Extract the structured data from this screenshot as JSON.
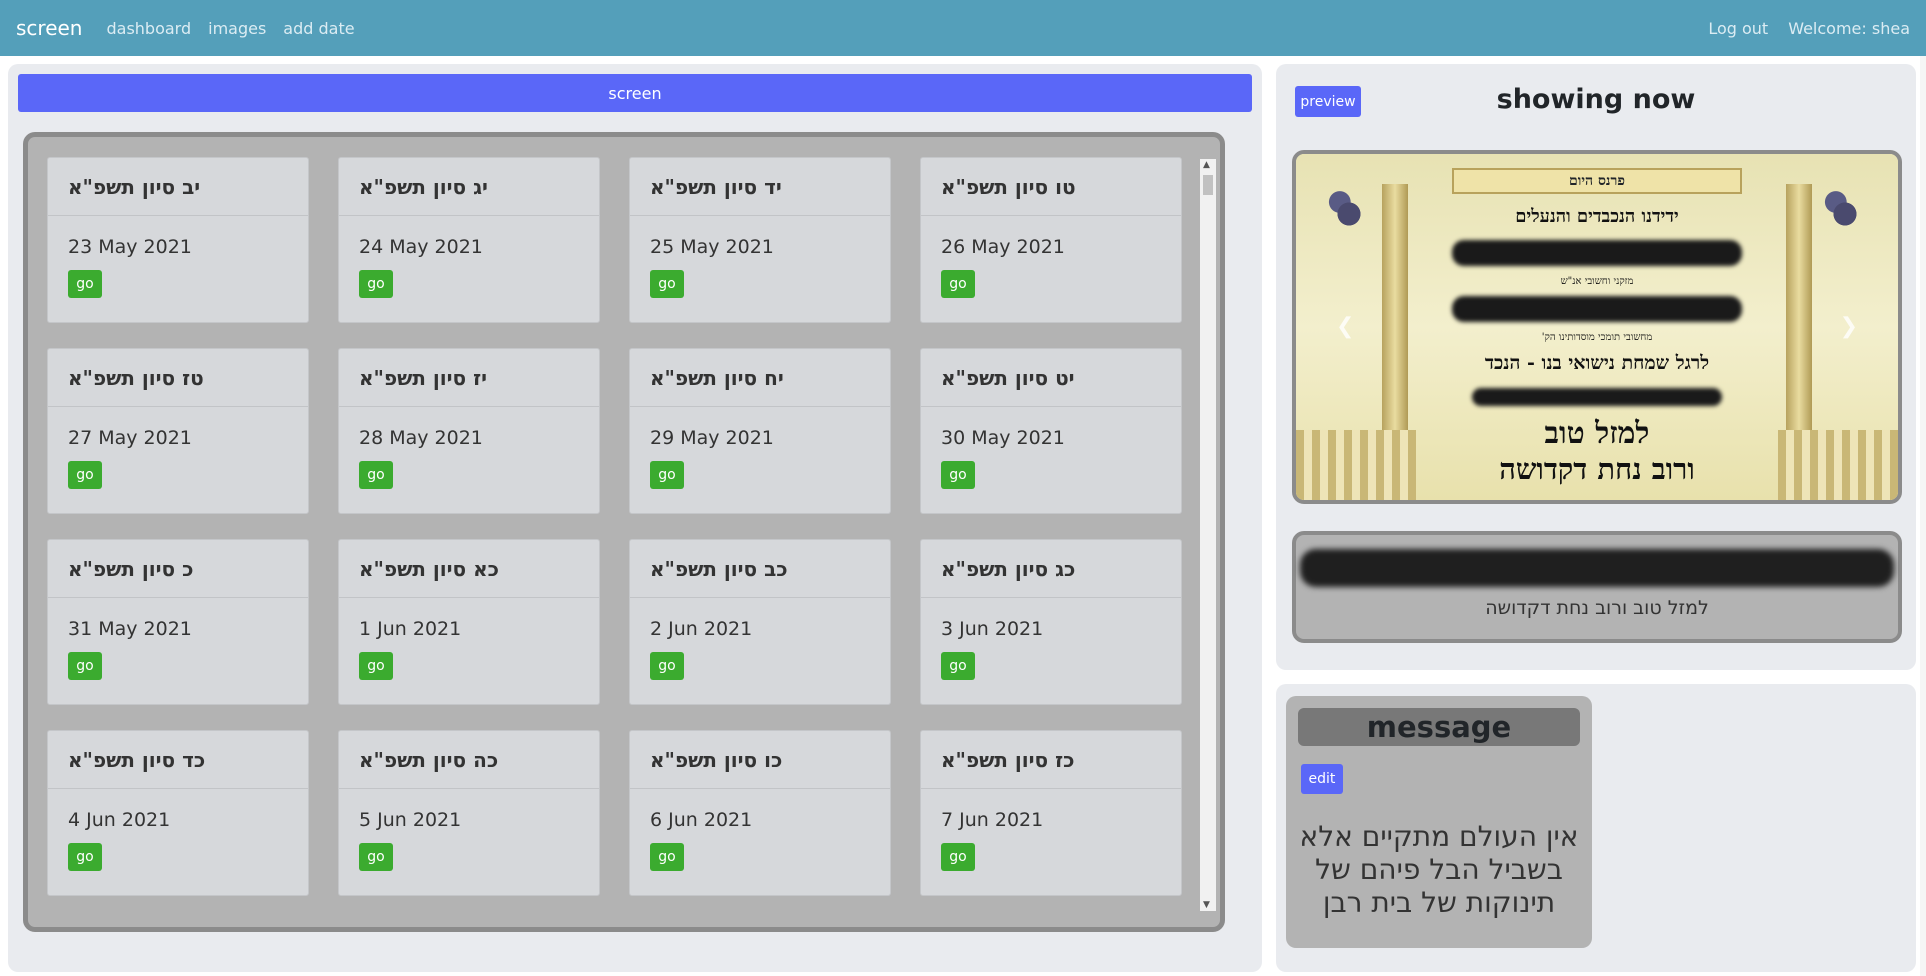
{
  "navbar": {
    "brand": "screen",
    "links": [
      "dashboard",
      "images",
      "add date"
    ],
    "logout": "Log out",
    "welcome": "Welcome: shea"
  },
  "screen_button": "screen",
  "dates": [
    {
      "hebrew": "יב סיון תשפ\"א",
      "date": "23 May 2021",
      "go": "go"
    },
    {
      "hebrew": "יג סיון תשפ\"א",
      "date": "24 May 2021",
      "go": "go"
    },
    {
      "hebrew": "יד סיון תשפ\"א",
      "date": "25 May 2021",
      "go": "go"
    },
    {
      "hebrew": "טו סיון תשפ\"א",
      "date": "26 May 2021",
      "go": "go"
    },
    {
      "hebrew": "טז סיון תשפ\"א",
      "date": "27 May 2021",
      "go": "go"
    },
    {
      "hebrew": "יז סיון תשפ\"א",
      "date": "28 May 2021",
      "go": "go"
    },
    {
      "hebrew": "יח סיון תשפ\"א",
      "date": "29 May 2021",
      "go": "go"
    },
    {
      "hebrew": "יט סיון תשפ\"א",
      "date": "30 May 2021",
      "go": "go"
    },
    {
      "hebrew": "כ סיון תשפ\"א",
      "date": "31 May 2021",
      "go": "go"
    },
    {
      "hebrew": "כא סיון תשפ\"א",
      "date": "1 Jun 2021",
      "go": "go"
    },
    {
      "hebrew": "כב סיון תשפ\"א",
      "date": "2 Jun 2021",
      "go": "go"
    },
    {
      "hebrew": "כג סיון תשפ\"א",
      "date": "3 Jun 2021",
      "go": "go"
    },
    {
      "hebrew": "כד סיון תשפ\"א",
      "date": "4 Jun 2021",
      "go": "go"
    },
    {
      "hebrew": "כה סיון תשפ\"א",
      "date": "5 Jun 2021",
      "go": "go"
    },
    {
      "hebrew": "כו סיון תשפ\"א",
      "date": "6 Jun 2021",
      "go": "go"
    },
    {
      "hebrew": "כז סיון תשפ\"א",
      "date": "7 Jun 2021",
      "go": "go"
    }
  ],
  "showing_now": {
    "preview_button": "preview",
    "title": "showing now",
    "slide": {
      "header": "פרנס היום",
      "line1": "ידידנו הנכבדים והנעלים",
      "line2": "מזקני וחשובי אנ\"ש",
      "line3": "מחשובי תומכי מוסדותינו הק'",
      "line4": "לרגל שמחת נישואי בנו - הנכד",
      "line5": "למזל טוב",
      "line6": "ורוב נחת דקדושה"
    },
    "caption": "למזל טוב ורוב נחת דקדושה"
  },
  "message": {
    "title": "message",
    "edit_button": "edit",
    "text": "אין העולם מתקיים אלא בשביל הבל פיהם של תינוקות של בית רבן"
  }
}
